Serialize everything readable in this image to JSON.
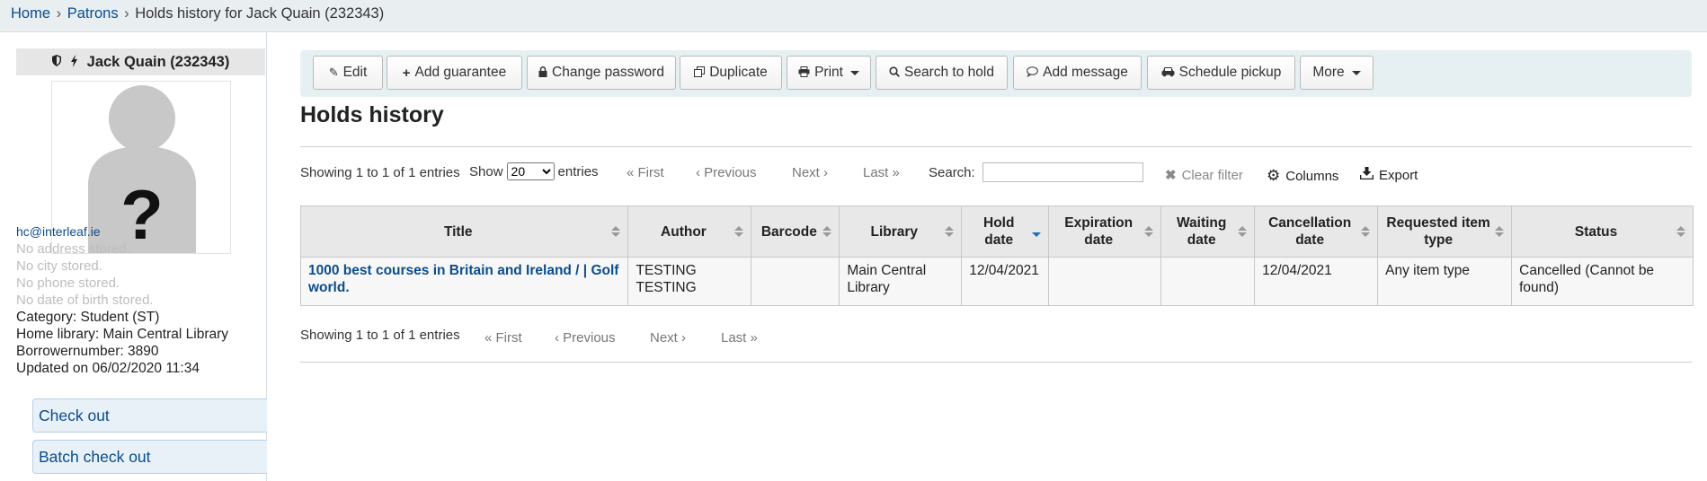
{
  "breadcrumb": {
    "home": "Home",
    "patrons": "Patrons",
    "current": "Holds history for Jack Quain (232343)",
    "separator": "›"
  },
  "patron": {
    "name": "Jack Quain (232343)",
    "email": "hc@interleaf.ie",
    "no_address": "No address stored.",
    "no_city": "No city stored.",
    "no_phone": "No phone stored.",
    "no_dob": "No date of birth stored.",
    "category": "Category: Student (ST)",
    "home_library": "Home library: Main Central Library",
    "borrowernumber": "Borrowernumber: 3890",
    "updated": "Updated on 06/02/2020 11:34",
    "avatar_placeholder": "?"
  },
  "sidebar_buttons": [
    "Check out",
    "Batch check out"
  ],
  "toolbar": {
    "edit": "Edit",
    "add_guarantee": "Add guarantee",
    "change_password": "Change password",
    "duplicate": "Duplicate",
    "print": "Print",
    "search_to_hold": "Search to hold",
    "add_message": "Add message",
    "schedule_pickup": "Schedule pickup",
    "more": "More"
  },
  "page_title": "Holds history",
  "table_controls": {
    "info": "Showing 1 to 1 of 1 entries",
    "show_label": "Show",
    "entries_label": "entries",
    "page_length": "20",
    "first": "« First",
    "previous": "‹ Previous",
    "next": "Next ›",
    "last": "Last »",
    "search_label": "Search:",
    "search_value": "",
    "clear_filter": "Clear filter",
    "columns": "Columns",
    "export": "Export"
  },
  "table": {
    "headers": [
      "Title",
      "Author",
      "Barcode",
      "Library",
      "Hold date",
      "Expiration date",
      "Waiting date",
      "Cancellation date",
      "Requested item type",
      "Status"
    ],
    "rows": [
      {
        "title": "1000 best courses in Britain and Ireland / | Golf world.",
        "author": "TESTING TESTING",
        "barcode": "",
        "library": "Main Central Library",
        "hold_date": "12/04/2021",
        "expiration_date": "",
        "waiting_date": "",
        "cancellation_date": "12/04/2021",
        "item_type": "Any item type",
        "status": "Cancelled (Cannot be found)"
      }
    ]
  },
  "icons": {
    "edit": "pencil-icon",
    "add_guarantee": "plus-icon",
    "change_password": "lock-icon",
    "duplicate": "copy-icon",
    "print": "printer-icon",
    "search": "search-icon",
    "message": "comment-icon",
    "pickup": "car-icon",
    "clear": "x-icon",
    "columns": "gear-icon",
    "export": "download-icon"
  },
  "colors": {
    "link": "#0b4c8c",
    "toolbar_bg": "#e6f0f2",
    "breadcrumb_bg": "#e9eef1",
    "sort_active": "#1a6dc4"
  }
}
